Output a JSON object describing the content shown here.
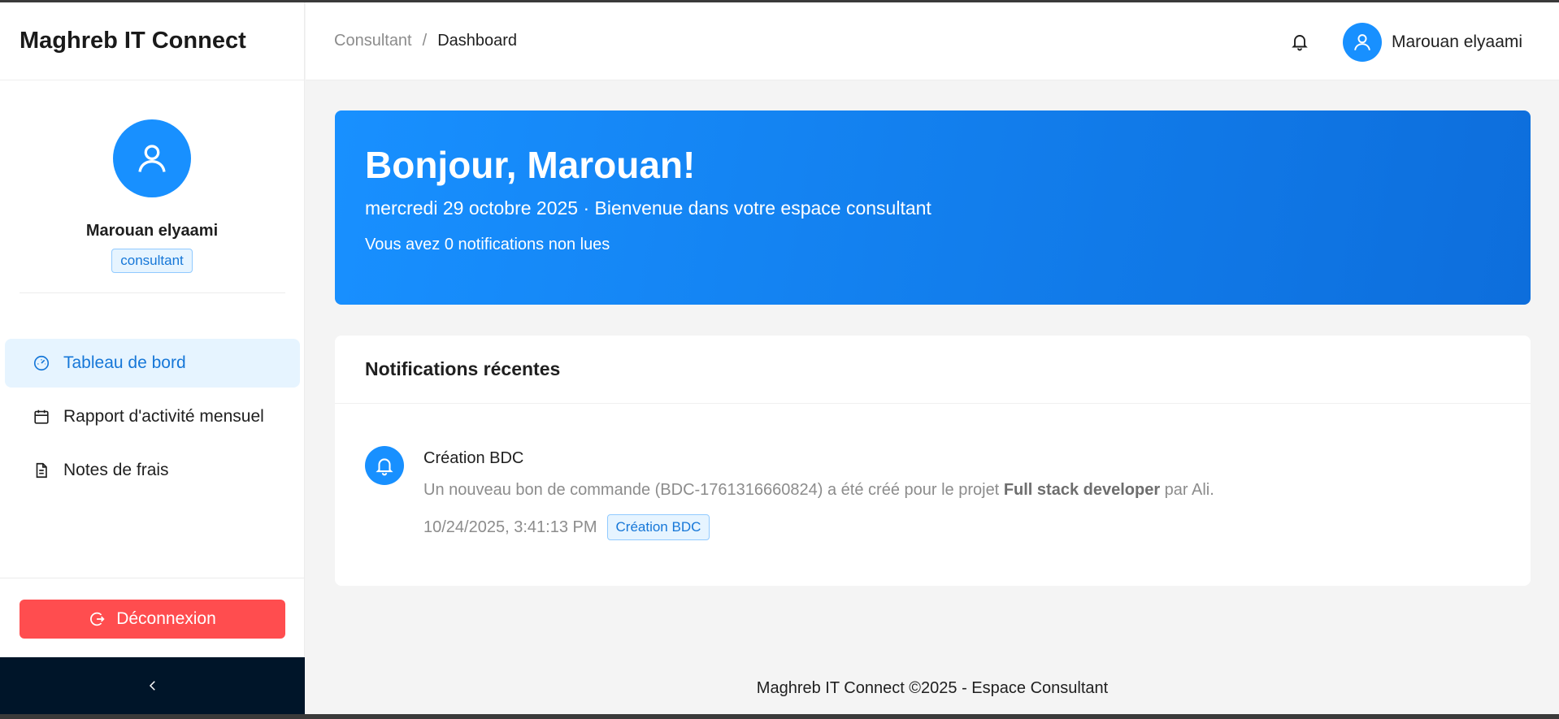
{
  "sidebar": {
    "brand": "Maghreb IT Connect",
    "profile": {
      "name": "Marouan elyaami",
      "role": "consultant"
    },
    "items": [
      {
        "label": "Tableau de bord",
        "icon": "dashboard-icon",
        "active": true
      },
      {
        "label": "Rapport d'activité mensuel",
        "icon": "calendar-icon",
        "active": false
      },
      {
        "label": "Notes de frais",
        "icon": "file-icon",
        "active": false
      }
    ],
    "logout_label": "Déconnexion",
    "collapse_icon": "chevron-left-icon"
  },
  "header": {
    "breadcrumb": {
      "parent": "Consultant",
      "separator": "/",
      "current": "Dashboard"
    },
    "user_name": "Marouan elyaami"
  },
  "banner": {
    "title": "Bonjour, Marouan!",
    "subtitle": "mercredi 29 octobre 2025 · Bienvenue dans votre espace consultant",
    "note": "Vous avez 0 notifications non lues"
  },
  "notifications": {
    "title": "Notifications récentes",
    "items": [
      {
        "title": "Création BDC",
        "desc_before": "Un nouveau bon de commande (BDC-1761316660824) a été créé pour le projet ",
        "desc_bold": "Full stack developer",
        "desc_after": " par Ali.",
        "time": "10/24/2025, 3:41:13 PM",
        "tag": "Création BDC"
      }
    ]
  },
  "footer": {
    "text": "Maghreb IT Connect ©2025 - Espace Consultant"
  },
  "colors": {
    "primary": "#1890ff",
    "danger": "#ff4d4f",
    "dark": "#001529"
  }
}
